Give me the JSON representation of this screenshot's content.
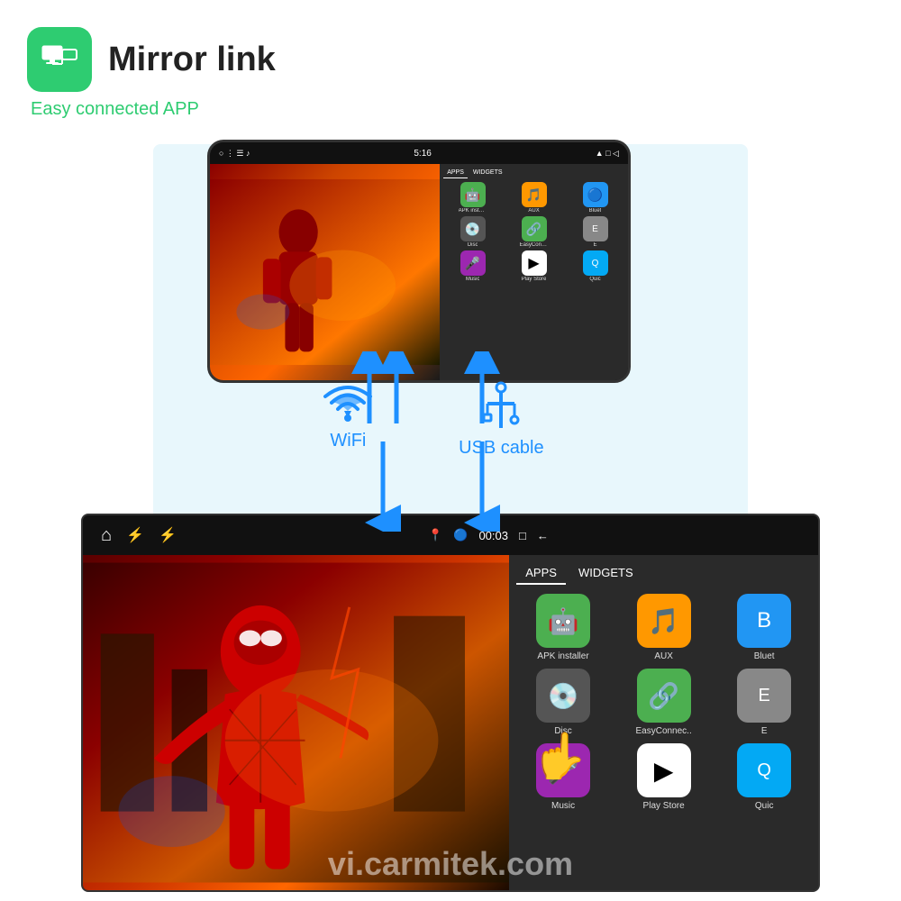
{
  "header": {
    "title": "Mirror link",
    "subtitle": "Easy connected APP",
    "icon_alt": "mirror-link-icon"
  },
  "phone": {
    "status_bar": {
      "left_icons": "○  ⋮  ☰  ♪",
      "time": "5:16",
      "right_icons": "▲  □  ◁"
    },
    "tabs": [
      "APPS",
      "WIDGETS"
    ],
    "apps": [
      {
        "label": "APK installer",
        "icon": "🤖",
        "class": "apk-icon"
      },
      {
        "label": "AUX",
        "icon": "🎵",
        "class": "aux-icon"
      },
      {
        "label": "Bluet",
        "icon": "🔵",
        "class": "bt-icon"
      },
      {
        "label": "Disc",
        "icon": "💿",
        "class": "disc-icon"
      },
      {
        "label": "EasyConnec..",
        "icon": "🔗",
        "class": "easy-icon"
      },
      {
        "label": "E",
        "icon": "E",
        "class": "e-icon"
      },
      {
        "label": "Music",
        "icon": "🎤",
        "class": "music-icon"
      },
      {
        "label": "Play Store",
        "icon": "▶",
        "class": "play-icon"
      },
      {
        "label": "Quic",
        "icon": "Q",
        "class": "quick-icon"
      }
    ]
  },
  "connection": {
    "wifi_label": "WiFi",
    "usb_label": "USB cable"
  },
  "car_unit": {
    "status_bar": {
      "left_icons": [
        "⌂",
        "⚡",
        "⚡"
      ],
      "center": [
        "📍",
        "🔵",
        "00:03",
        "□",
        "←"
      ],
      "right": []
    },
    "tabs": [
      "APPS",
      "WIDGETS"
    ],
    "apps": [
      {
        "label": "APK installer",
        "icon": "🤖",
        "class": "apk-icon"
      },
      {
        "label": "AUX",
        "icon": "🎵",
        "class": "aux-icon"
      },
      {
        "label": "Bluet",
        "icon": "🔵",
        "class": "bt-icon"
      },
      {
        "label": "Disc",
        "icon": "💿",
        "class": "disc-icon"
      },
      {
        "label": "EasyConnec..",
        "icon": "🔗",
        "class": "easy-icon"
      },
      {
        "label": "E",
        "icon": "E",
        "class": "e-icon"
      },
      {
        "label": "Music",
        "icon": "🎤",
        "class": "music-icon"
      },
      {
        "label": "Play Store",
        "icon": "▶",
        "class": "play-icon"
      },
      {
        "label": "Quic",
        "icon": "Q",
        "class": "quick-icon"
      }
    ]
  },
  "watermark": "vi.carmitek.com"
}
